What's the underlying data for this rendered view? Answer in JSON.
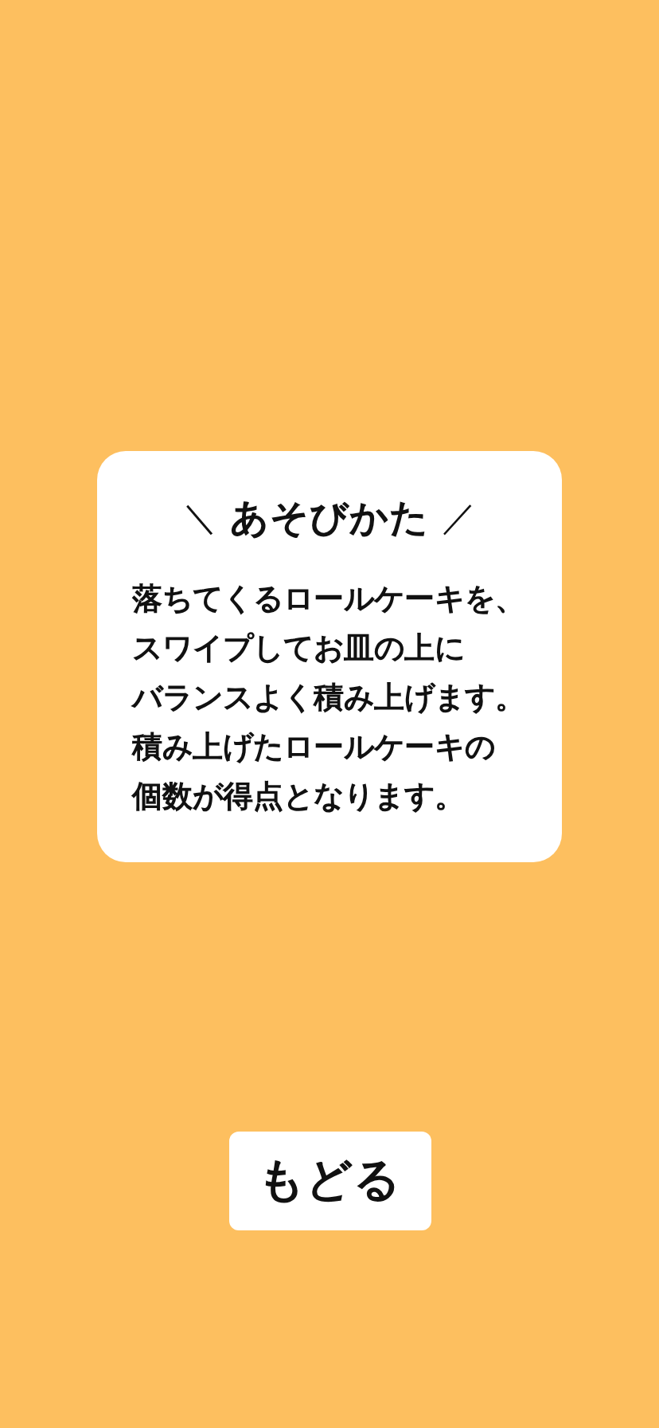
{
  "card": {
    "title_left": "＼",
    "title": "あそびかた",
    "title_right": "／",
    "lines": [
      "落ちてくるロールケーキを、",
      "スワイプしてお皿の上に",
      "バランスよく積み上げます。",
      "積み上げたロールケーキの",
      "個数が得点となります。"
    ]
  },
  "back_button": {
    "label": "もどる"
  }
}
